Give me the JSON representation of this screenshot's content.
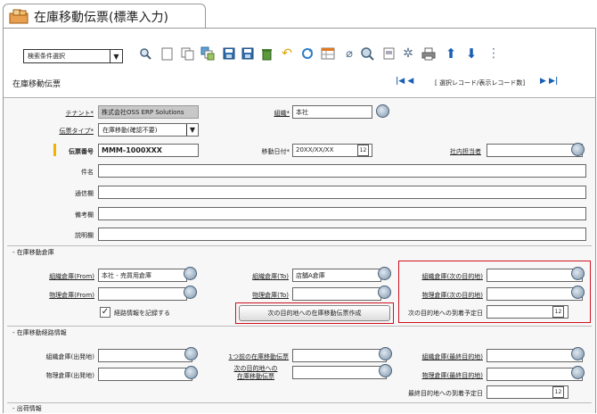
{
  "title": "在庫移動伝票(標準入力)",
  "toolbar": {
    "search_condition": "検索条件選択",
    "icons": [
      "search-icon",
      "new-doc-icon",
      "copy-icon",
      "multi-copy-icon",
      "save-icon",
      "delete-icon",
      "undo-icon",
      "refresh-icon",
      "table-icon",
      "attach-icon",
      "print-preview-icon",
      "sheet-icon",
      "gear-icon",
      "print-icon",
      "arrow-up-icon",
      "arrow-down-icon",
      "more-icon"
    ]
  },
  "screen_title": "在庫移動伝票",
  "nav": {
    "first": "|◀ ◀",
    "record_text": "[ 選択レコード/表示レコード数]",
    "last": "▶ ▶|"
  },
  "header": {
    "tenant_label": "テナント*",
    "tenant_value": "株式会社OSS ERP Solutions",
    "org_label": "組織*",
    "org_value": "本社",
    "slip_type_label": "伝票タイプ*",
    "slip_type_value": "在庫移動(確認不要)",
    "slip_no_label": "伝票番号",
    "slip_no_value": "MMM-1000XXX",
    "move_date_label": "移動日付*",
    "move_date_value": "20XX/XX/XX",
    "staff_label": "社内担当者",
    "subject_label": "件名",
    "comm_label": "通信欄",
    "remarks_label": "備考欄",
    "desc_label": "説明欄"
  },
  "warehouse": {
    "section": "- 在庫移動倉庫",
    "from_org_label": "組織倉庫(From)",
    "from_org_value": "本社 - 売買用倉庫",
    "to_org_label": "組織倉庫(To)",
    "to_org_value": "店舗A倉庫",
    "next_org_label": "組織倉庫(次の目的地)",
    "from_phys_label": "物理倉庫(From)",
    "to_phys_label": "物理倉庫(To)",
    "next_phys_label": "物理倉庫(次の目的地)",
    "record_route_label": "経路情報を記録する",
    "create_button": "次の目的地への在庫移動伝票作成",
    "next_arrival_label": "次の目的地への到着予定日"
  },
  "route": {
    "section": "- 在庫移動経路情報",
    "org_origin_label": "組織倉庫(出発地)",
    "prev_slip_label": "1つ前の在庫移動伝票",
    "org_final_label": "組織倉庫(最終目的地)",
    "phys_origin_label": "物理倉庫(出発地)",
    "next_slip_label_1": "次の目的地への",
    "next_slip_label_2": "在庫移動伝票",
    "phys_final_label": "物理倉庫(最終目的地)",
    "final_arrival_label": "最終目的地への到着予定日"
  },
  "shipping": {
    "section": "- 出荷情報"
  },
  "colors": {
    "red_box": "#d01020",
    "accent_bar": "#f0b400",
    "blue_nav": "#1a5fb4"
  }
}
